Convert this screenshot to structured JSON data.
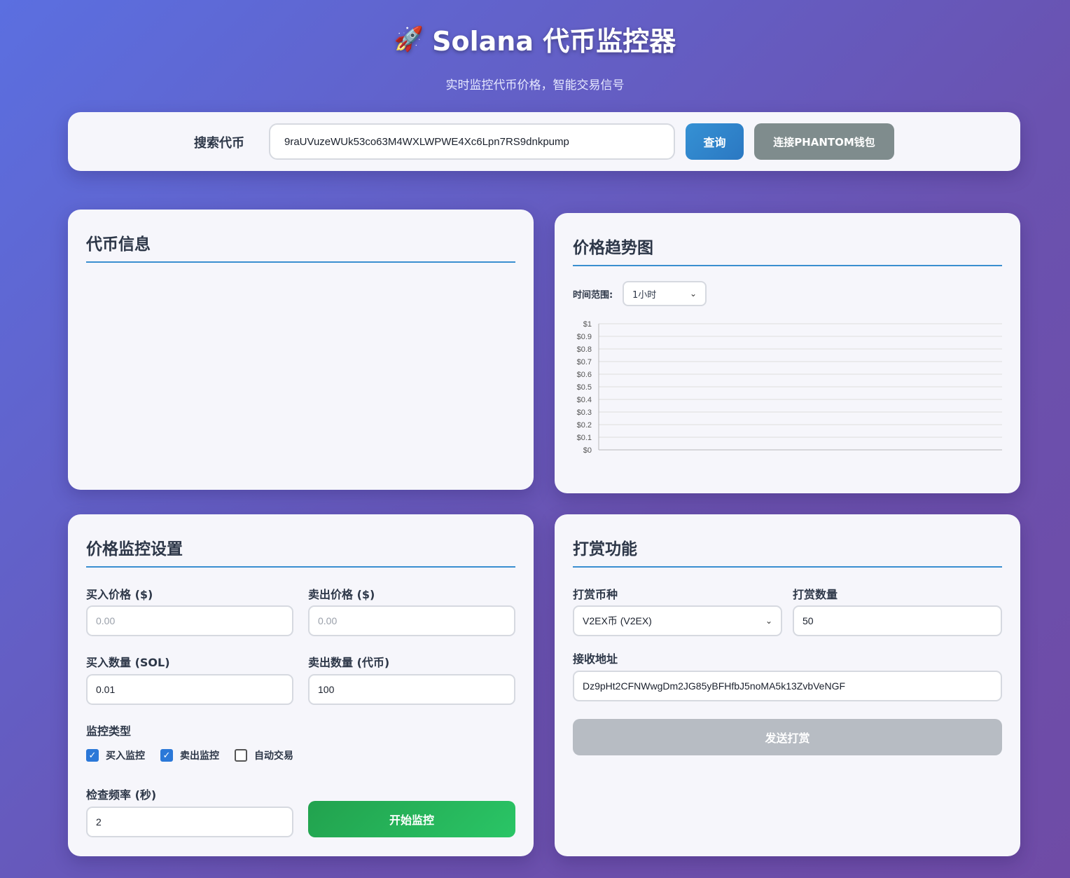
{
  "header": {
    "rocket_icon": "🚀",
    "title": "Solana 代币监控器",
    "subtitle": "实时监控代币价格，智能交易信号"
  },
  "search": {
    "label": "搜索代币",
    "value": "9raUVuzeWUk53co63M4WXLWPWE4Xc6Lpn7RS9dnkpump",
    "query_button": "查询",
    "phantom_button": "连接PHANTOM钱包"
  },
  "token_info": {
    "title": "代币信息"
  },
  "price_chart": {
    "title": "价格趋势图",
    "range_label": "时间范围:",
    "range_selected": "1小时"
  },
  "chart_data": {
    "type": "line",
    "title": "",
    "xlabel": "",
    "ylabel": "",
    "ylim": [
      0,
      1
    ],
    "y_ticks": [
      "$0",
      "$0.1",
      "$0.2",
      "$0.3",
      "$0.4",
      "$0.5",
      "$0.6",
      "$0.7",
      "$0.8",
      "$0.9",
      "$1"
    ],
    "series": [],
    "grid": true
  },
  "monitor": {
    "title": "价格监控设置",
    "buy_price_label": "买入价格 ($)",
    "buy_price_placeholder": "0.00",
    "sell_price_label": "卖出价格 ($)",
    "sell_price_placeholder": "0.00",
    "buy_amount_label": "买入数量 (SOL)",
    "buy_amount_value": "0.01",
    "sell_amount_label": "卖出数量 (代币)",
    "sell_amount_value": "100",
    "type_label": "监控类型",
    "options": [
      {
        "label": "买入监控",
        "checked": true
      },
      {
        "label": "卖出监控",
        "checked": true
      },
      {
        "label": "自动交易",
        "checked": false
      }
    ],
    "frequency_label": "检查频率 (秒)",
    "frequency_value": "2",
    "start_button": "开始监控"
  },
  "tip": {
    "title": "打赏功能",
    "currency_label": "打赏币种",
    "currency_selected": "V2EX币 (V2EX)",
    "amount_label": "打赏数量",
    "amount_value": "50",
    "address_label": "接收地址",
    "address_value": "Dz9pHt2CFNWwgDm2JG85yBFHfbJ5noMA5k13ZvbVeNGF",
    "send_button": "发送打赏"
  },
  "colors": {
    "accent": "#3a8fd0",
    "start_green": "#22a24e",
    "phantom_gray": "#7f8c8d",
    "disabled_gray": "#b7bcc3"
  }
}
